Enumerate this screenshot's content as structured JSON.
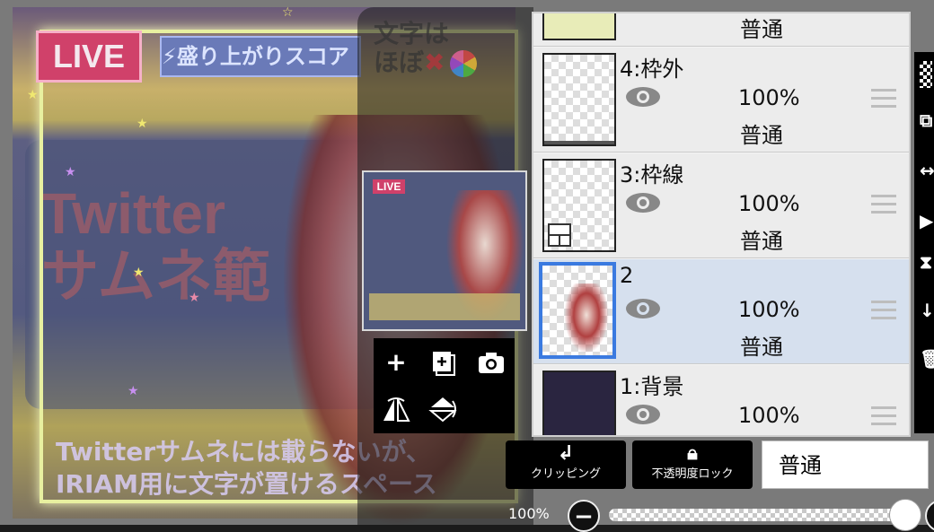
{
  "canvas": {
    "live_text": "LIVE",
    "score_text": "⚡盛り上がりスコア",
    "hint_text_1": "文字は",
    "hint_text_2": "ほぼ",
    "big_text_1": "Twitter",
    "big_text_2": "サムネ範",
    "bottom_text_1": "Twitterサムネには載らないが、",
    "bottom_text_2": "IRIAM用に文字が置けるスペース"
  },
  "preview": {
    "live_text": "LIVE"
  },
  "tool_popup": {
    "add_icon": "plus-icon",
    "add_layer_icon": "add-layer-icon",
    "camera_icon": "camera-icon",
    "flip_horizontal_icon": "flip-horizontal-icon",
    "flip_vertical_icon": "flip-vertical-icon"
  },
  "layers": [
    {
      "name": "",
      "opacity": "",
      "blend": "普通",
      "thumb": "pattern"
    },
    {
      "name": "4:枠外",
      "opacity": "100%",
      "blend": "普通",
      "thumb": "transparent"
    },
    {
      "name": "3:枠線",
      "opacity": "100%",
      "blend": "普通",
      "thumb": "transparent",
      "clip": true
    },
    {
      "name": "2",
      "opacity": "100%",
      "blend": "普通",
      "thumb": "character",
      "selected": true
    },
    {
      "name": "1:背景",
      "opacity": "100%",
      "blend": "",
      "thumb": "dark"
    }
  ],
  "bottom": {
    "clipping_label": "クリッピング",
    "alpha_lock_label": "不透明度ロック",
    "alpha_lock_icon_text": "α",
    "blend_mode_value": "普通",
    "opacity_value": "100%"
  },
  "colors": {
    "selected_layer": "#d6e0ee",
    "selected_border": "#3a7ae0",
    "live_badge": "#d0416a"
  }
}
